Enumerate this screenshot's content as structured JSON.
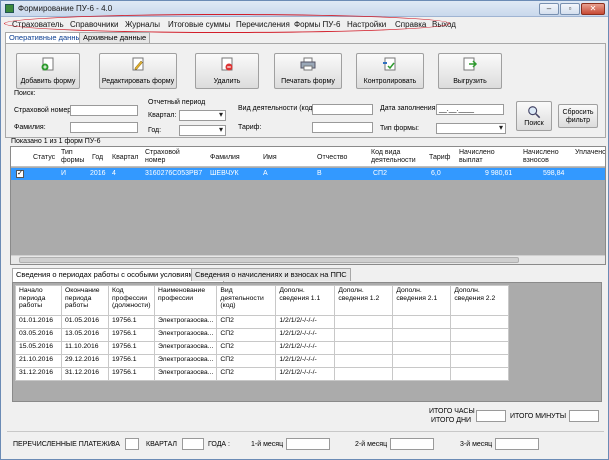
{
  "window": {
    "title": "Формирование ПУ-6 - 4.0",
    "accent": "#d21e2a"
  },
  "menu": [
    "Страхователь",
    "Справочники",
    "Журналы",
    "Итоговые суммы",
    "Перечисления",
    "Формы ПУ-6",
    "Настройки",
    "Справка",
    "Выход"
  ],
  "tabs_top": {
    "operative": "Оперативные данные",
    "archive": "Архивные данные"
  },
  "toolbar": {
    "add": "Добавить форму",
    "edit": "Редактировать форму",
    "delete": "Удалить",
    "print": "Печатать форму",
    "control": "Контролировать",
    "export": "Выгрузить"
  },
  "search": {
    "title": "Поиск:",
    "ins_number_label": "Страховой номер:",
    "surname_label": "Фамилия:",
    "period_label": "Отчетный период",
    "quarter_label": "Квартал:",
    "year_label": "Год:",
    "activity_label": "Вид деятельности (код):",
    "tariff_label": "Тариф:",
    "fill_date_label": "Дата заполнения:",
    "fill_date_value": "__.__.____",
    "form_type_label": "Тип формы:",
    "search_button": "Поиск",
    "reset_button": "Сбросить фильтр"
  },
  "shown_info": "Показано 1 из 1 форм ПУ-6",
  "forms_table": {
    "headers": [
      "Статус",
      "Тип формы",
      "Год",
      "Квартал",
      "Страховой номер",
      "Фамилия",
      "Имя",
      "Отчество",
      "Код вида деятельности",
      "Тариф",
      "Начислено выплат",
      "Начислено взносов",
      "Уплачено"
    ],
    "row": {
      "check": "✓",
      "type": "И",
      "year": "2016",
      "quarter": "4",
      "ins_number": "3160276C053PB7",
      "surname": "ШЕВЧУК",
      "name": "А",
      "patronymic": "В",
      "activity_code": "СП2",
      "tariff": "6,0",
      "payments": "9 980,61",
      "contributions": "598,84"
    }
  },
  "tabs_mid": {
    "periods": "Сведения о периодах работы с особыми условиями труда",
    "accruals": "Сведения о начислениях и взносах на ППС"
  },
  "periods_table": {
    "headers": [
      "Начало периода работы",
      "Окончание периода работы",
      "Код профессии (должности)",
      "Наименование профессии",
      "Вид деятельности (код)",
      "Дополн. сведения 1.1",
      "Дополн. сведения 1.2",
      "Дополн. сведения 2.1",
      "Дополн. сведения 2.2"
    ],
    "rows": [
      [
        "01.01.2016",
        "01.05.2016",
        "19756.1",
        "Электрогазосва...",
        "СП2",
        "1/2/1/2/-/-/-/-",
        "",
        "",
        ""
      ],
      [
        "03.05.2016",
        "13.05.2016",
        "19756.1",
        "Электрогазосва...",
        "СП2",
        "1/2/1/2/-/-/-/-",
        "",
        "",
        ""
      ],
      [
        "15.05.2016",
        "11.10.2016",
        "19756.1",
        "Электрогазосва...",
        "СП2",
        "1/2/1/2/-/-/-/-",
        "",
        "",
        ""
      ],
      [
        "21.10.2016",
        "29.12.2016",
        "19756.1",
        "Электрогазосва...",
        "СП2",
        "1/2/1/2/-/-/-/-",
        "",
        "",
        ""
      ],
      [
        "31.12.2016",
        "31.12.2016",
        "19756.1",
        "Электрогазосва...",
        "СП2",
        "1/2/1/2/-/-/-/-",
        "",
        "",
        ""
      ]
    ]
  },
  "totals": {
    "hours_label": "ИТОГО ЧАСЫ",
    "days_label": "ИТОГО ДНИ",
    "minutes_label": "ИТОГО МИНУТЫ"
  },
  "footer": {
    "transferred": "ПЕРЕЧИСЛЕННЫЕ ПЛАТЕЖИ",
    "for": "ЗА",
    "quarter": "КВАРТАЛ",
    "year": "ГОДА :",
    "month1": "1-й месяц",
    "month2": "2-й месяц",
    "month3": "3-й месяц"
  }
}
